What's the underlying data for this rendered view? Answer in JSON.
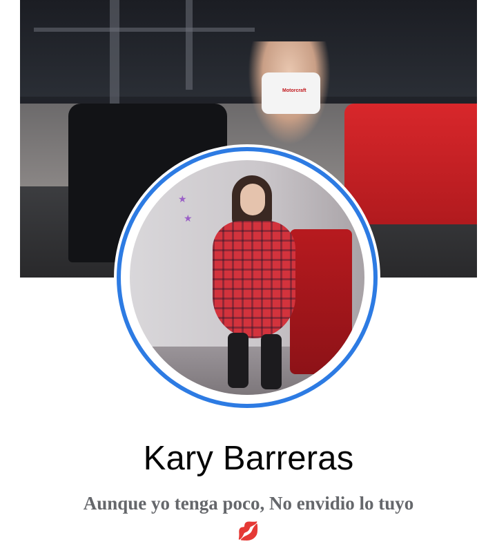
{
  "profile": {
    "name": "Kary Barreras",
    "bio": "Aunque yo tenga poco, No envidio lo tuyo",
    "bio_emoji": "💋"
  },
  "cover": {
    "shirt_text": "Motorcraft"
  },
  "colors": {
    "avatar_ring": "#2d7be3",
    "name_text": "#050505",
    "bio_text": "#65676b"
  },
  "icons": {
    "bio_emoji": "kiss-mark-icon"
  }
}
